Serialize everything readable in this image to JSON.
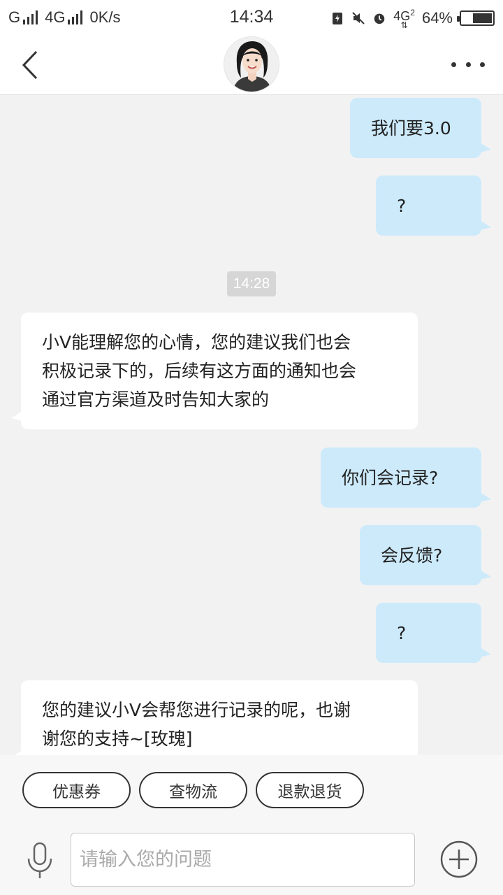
{
  "status_bar": {
    "carrier1": "G",
    "carrier2": "4G",
    "speed": "0K/s",
    "time": "14:34",
    "network_right": "4G",
    "network_sub": "2",
    "battery_percent": "64%",
    "battery_level": 0.64
  },
  "header": {
    "avatar_icon": "female-agent-avatar"
  },
  "messages": [
    {
      "side": "right",
      "text": "我们要3.0"
    },
    {
      "side": "right",
      "text": "?"
    },
    {
      "side": "left",
      "lines": [
        "小V能理解您的心情，您的建议我们也会",
        "积极记录下的，后续有这方面的通知也会",
        "通过官方渠道及时告知大家的"
      ]
    },
    {
      "side": "right",
      "text": "你们会记录?"
    },
    {
      "side": "right",
      "text": "会反馈?"
    },
    {
      "side": "right",
      "text": "?"
    },
    {
      "side": "left",
      "lines": [
        "您的建议小V会帮您进行记录的呢，也谢",
        "谢您的支持~[玫瑰]"
      ]
    }
  ],
  "timestamp": "14:28",
  "quick_actions": [
    "优惠券",
    "查物流",
    "退款退货"
  ],
  "input": {
    "placeholder": "请输入您的问题",
    "value": ""
  },
  "colors": {
    "outgoing_bubble": "#cdeafb",
    "incoming_bubble": "#ffffff",
    "chat_background": "#f2f2f2"
  }
}
